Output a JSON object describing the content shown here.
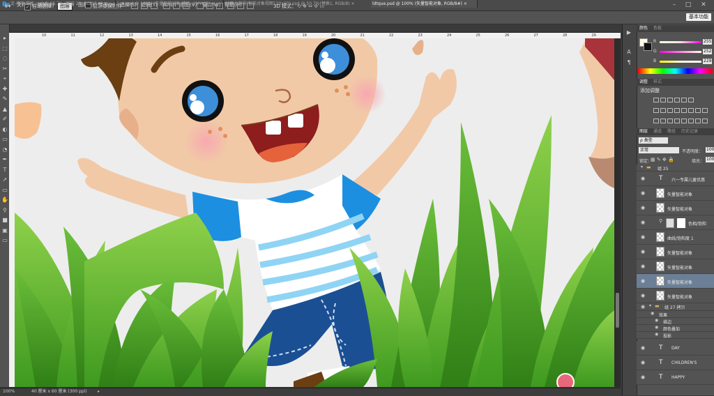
{
  "app": {
    "logo": "Ps"
  },
  "menu": [
    "文件(F)",
    "编辑(E)",
    "图像(I)",
    "图层(L)",
    "类型(Y)",
    "选择(S)",
    "滤镜(T)",
    "3D(D)",
    "视图(V)",
    "窗口(W)",
    "帮助(H)"
  ],
  "options": {
    "auto_select_label": "自动选择：",
    "auto_select_value": "图层",
    "show_transform_label": "显示变换控件",
    "mode_3d_label": "3D 模式："
  },
  "workspace_label": "基本功能",
  "tabs": [
    "淀-横版 样机.psd @ 66.7% (图层 21, RGB/8#) ×",
    "juxi.psd @ 100% (矢量智能对象 拷贝, CMYK/8) ×",
    "03舞台背景(智能对象视图120x60).psd @ 50.7%(替换1, RGB/8) ×",
    "ldtque.psd @ 100% (矢量智能对象, RGB/8#) ×"
  ],
  "ruler_h_ticks": [
    "10",
    "11",
    "12",
    "13",
    "14",
    "15",
    "16",
    "17",
    "18",
    "19",
    "20",
    "21",
    "22",
    "23",
    "24",
    "25",
    "26",
    "27",
    "28",
    "29",
    "30"
  ],
  "status": {
    "zoom": "100%",
    "doc_info": "40 厘米 x 60 厘米 (300 ppi)"
  },
  "color_panel": {
    "tabs": [
      "颜色",
      "色板"
    ],
    "r_label": "R",
    "g_label": "G",
    "b_label": "B",
    "r_value": "255",
    "g_value": "252",
    "b_value": "229",
    "fg": "#fffce5",
    "bg": "#111111"
  },
  "adjust_panel": {
    "tabs": [
      "调整",
      "样式"
    ],
    "title": "添加调整"
  },
  "layers_panel": {
    "tabs": [
      "图层",
      "通道",
      "路径",
      "历史记录"
    ],
    "filter_label": "ρ 类型",
    "blend_mode": "正常",
    "opacity_label": "不透明度：",
    "opacity_value": "100",
    "lock_label": "锁定：",
    "fill_label": "填充：",
    "fill_value": "100",
    "group_top": "组 25",
    "layers": [
      {
        "name": "六一专属儿童优惠",
        "kind": "text"
      },
      {
        "name": "矢量智能对象",
        "kind": "smart"
      },
      {
        "name": "矢量智能对象",
        "kind": "smart"
      },
      {
        "name": "色相/饱和",
        "kind": "adj"
      },
      {
        "name": "曲线/饱和度 1",
        "kind": "adj2"
      },
      {
        "name": "矢量智能对象",
        "kind": "smart"
      },
      {
        "name": "矢量智能对象",
        "kind": "smart"
      },
      {
        "name": "矢量智能对象",
        "kind": "smart",
        "selected": true
      },
      {
        "name": "矢量智能对象",
        "kind": "smart"
      }
    ],
    "group_copy": "组 27 拷贝",
    "effects_label": "效果",
    "effects": [
      "描边",
      "颜色叠加",
      "投影"
    ],
    "text_layers": [
      "DAY",
      "CHILDREN'S",
      "HAPPY"
    ]
  }
}
